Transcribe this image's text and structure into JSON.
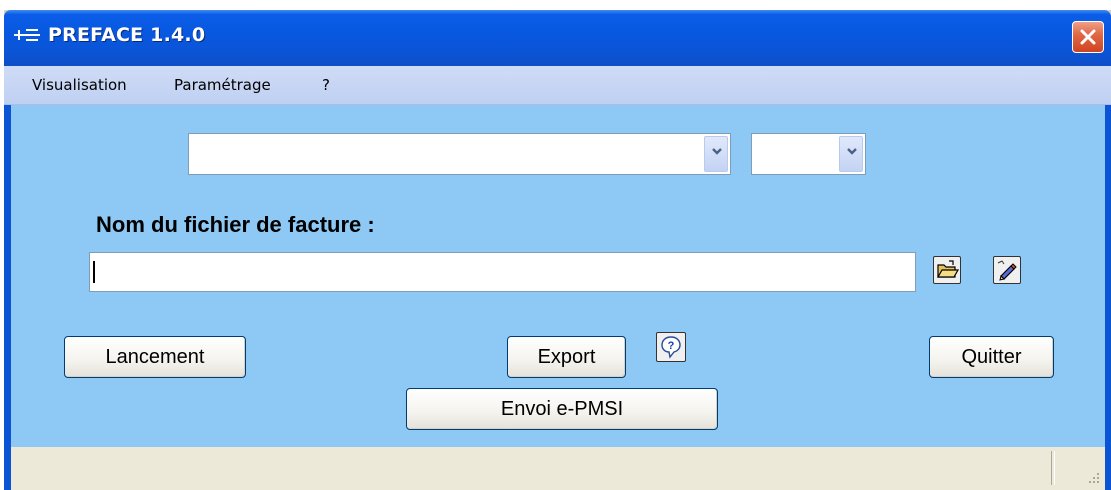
{
  "window": {
    "title": "PREFACE 1.4.0"
  },
  "menu": {
    "items": [
      {
        "label": "Visualisation"
      },
      {
        "label": "Paramétrage"
      },
      {
        "label": "?"
      }
    ]
  },
  "form": {
    "primary_select_value": "",
    "secondary_select_value": "",
    "file_label": "Nom du fichier de facture :",
    "file_input_value": ""
  },
  "icons": {
    "open_folder": "open-folder-icon",
    "edit": "edit-pen-icon",
    "help": "help-icon",
    "close": "close-icon",
    "dropdown": "chevron-down-icon"
  },
  "buttons": {
    "launch": "Lancement",
    "export": "Export",
    "quit": "Quitter",
    "send": "Envoi  e-PMSI"
  },
  "colors": {
    "title_bar": "#0858e0",
    "client_background": "#8dc9f4",
    "menu_background": "#c6d6f4",
    "close_button": "#e06a48"
  }
}
